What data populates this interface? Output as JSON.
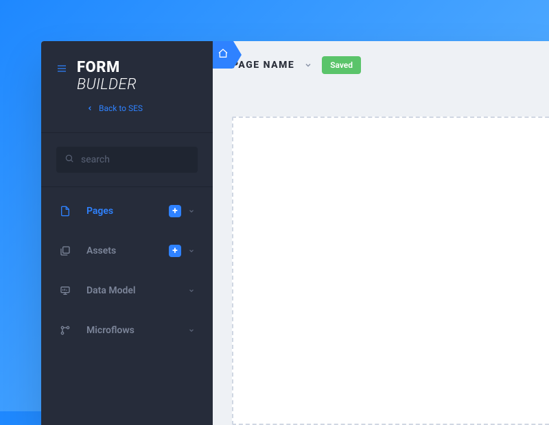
{
  "brand": {
    "title_line1": "FORM",
    "title_line2": "BUILDER"
  },
  "back_link": {
    "label": "Back to SES"
  },
  "search": {
    "placeholder": "search"
  },
  "nav": {
    "items": [
      {
        "label": "Pages",
        "has_plus": true,
        "active": true
      },
      {
        "label": "Assets",
        "has_plus": true,
        "active": false
      },
      {
        "label": "Data Model",
        "has_plus": false,
        "active": false
      },
      {
        "label": "Microflows",
        "has_plus": false,
        "active": false
      }
    ]
  },
  "header": {
    "page_name": "PAGE NAME",
    "status_badge": "Saved"
  },
  "colors": {
    "accent": "#2f82ff",
    "sidebar": "#262c3a",
    "success": "#5ac46a"
  }
}
